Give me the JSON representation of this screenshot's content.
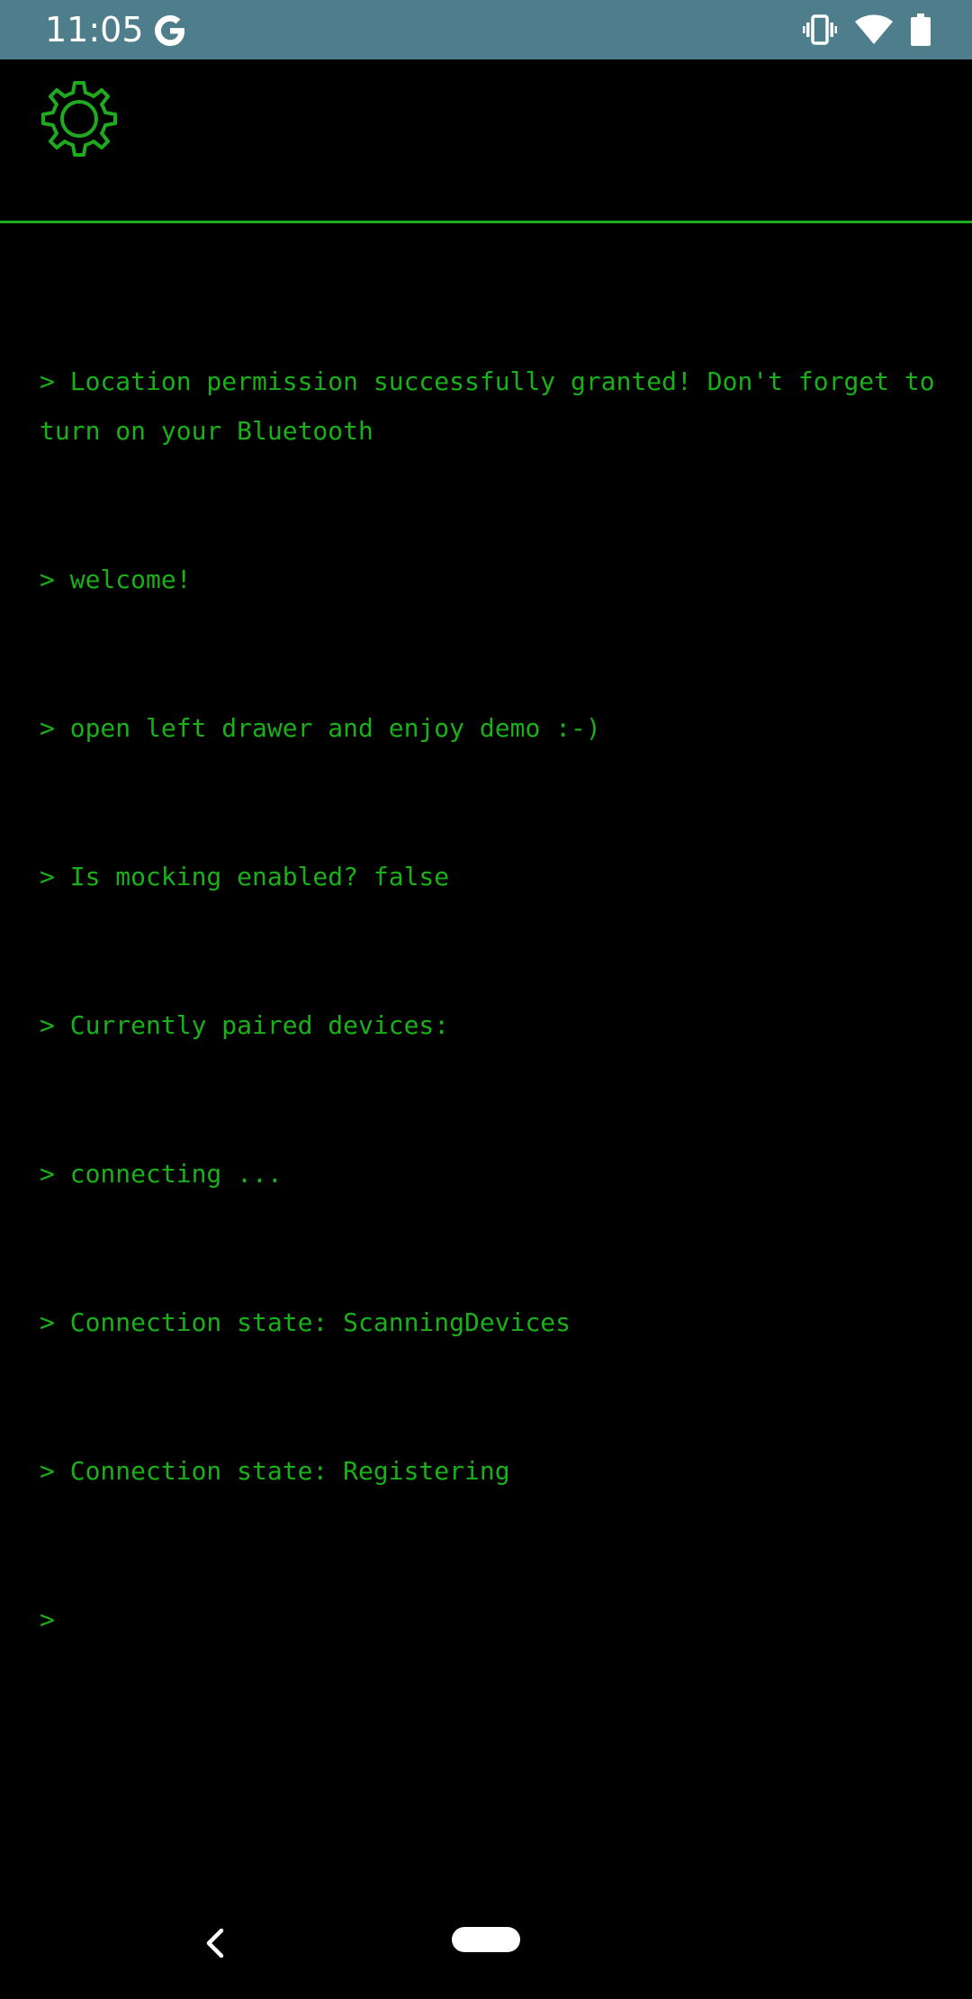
{
  "status_bar": {
    "time": "11:05",
    "icons": [
      "google-g-icon",
      "vibrate-icon",
      "wifi-icon",
      "battery-icon"
    ],
    "background_color": "#4e7d8c"
  },
  "toolbar": {
    "settings_icon": "gear-icon",
    "accent_color": "#1faa1f"
  },
  "console": {
    "text_color": "#19b019",
    "lines": [
      "> Location permission successfully granted! Don't forget to turn on your Bluetooth",
      "> welcome!",
      "> open left drawer and enjoy demo :-)",
      "> Is mocking enabled? false",
      "> Currently paired devices:",
      "> connecting ...",
      "> Connection state: ScanningDevices",
      "> Connection state: Registering",
      ">"
    ]
  },
  "nav_bar": {
    "back_icon": "back-chevron-icon",
    "home_icon": "home-pill-icon"
  }
}
